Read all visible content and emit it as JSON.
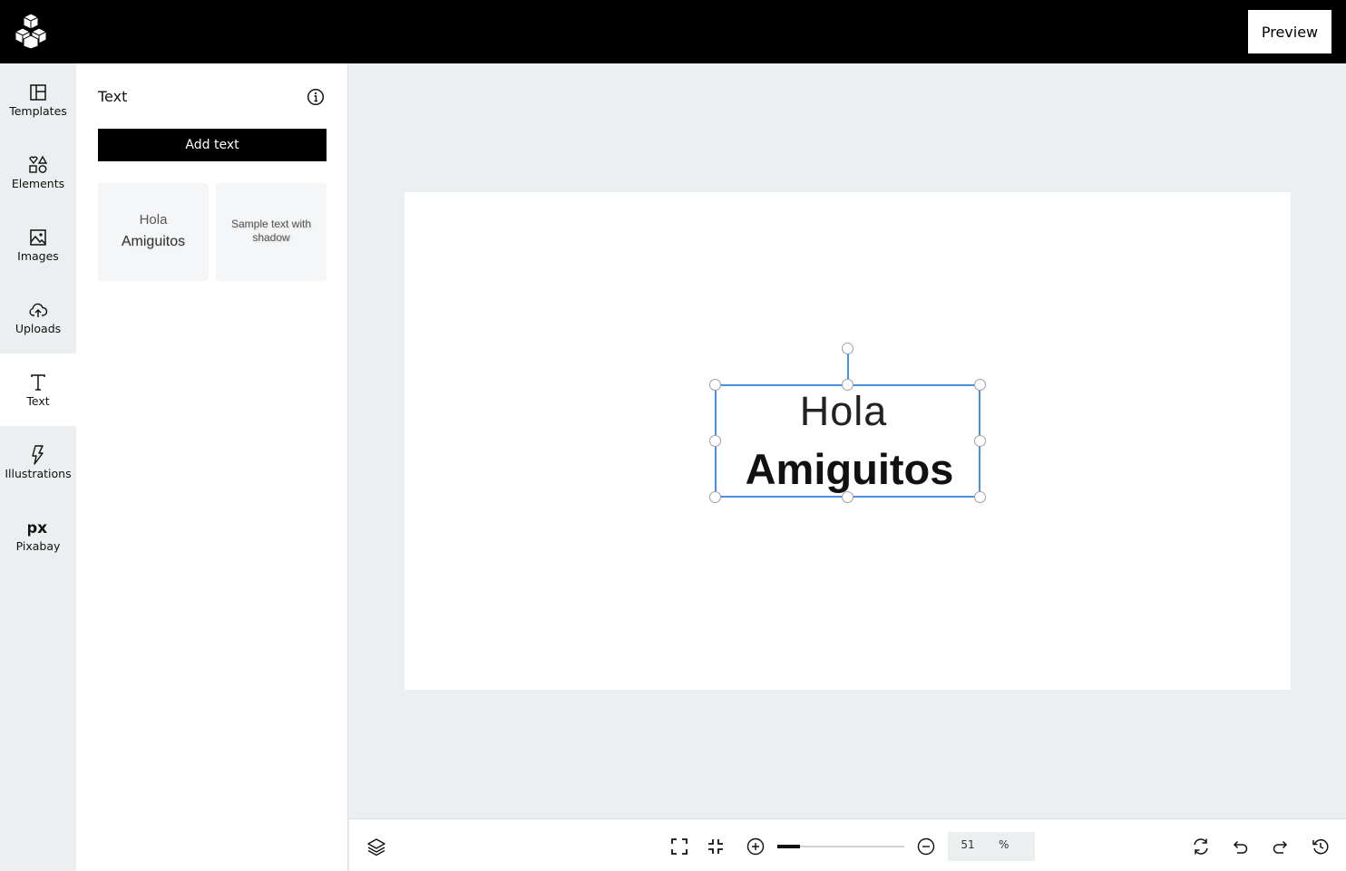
{
  "topbar": {
    "logo_icon": "cubes-logo-icon",
    "preview_label": "Preview"
  },
  "sidenav": {
    "items": [
      {
        "label": "Templates",
        "icon": "templates-icon"
      },
      {
        "label": "Elements",
        "icon": "elements-icon"
      },
      {
        "label": "Images",
        "icon": "image-icon"
      },
      {
        "label": "Uploads",
        "icon": "cloud-upload-icon"
      },
      {
        "label": "Text",
        "icon": "text-icon",
        "active": true
      },
      {
        "label": "Illustrations",
        "icon": "lightning-icon"
      },
      {
        "label": "Pixabay",
        "icon": "pixabay-icon"
      }
    ]
  },
  "panel": {
    "title": "Text",
    "info_icon": "info-icon",
    "add_text_label": "Add text",
    "presets": [
      {
        "line1": "Hola",
        "line2": "Amiguitos"
      },
      {
        "text": "Sample text with shadow"
      }
    ]
  },
  "canvas": {
    "selected_text_line1": "Hola",
    "selected_text_line2": "Amiguitos",
    "selection_color": "#4a90e2"
  },
  "bottombar": {
    "zoom_value": "51",
    "zoom_unit": "%",
    "zoom_slider_fraction": 0.18,
    "icons": [
      "layers-icon",
      "fullscreen-icon",
      "fit-screen-icon",
      "zoom-in-icon",
      "zoom-out-icon",
      "refresh-icon",
      "undo-icon",
      "redo-icon",
      "history-icon"
    ]
  }
}
